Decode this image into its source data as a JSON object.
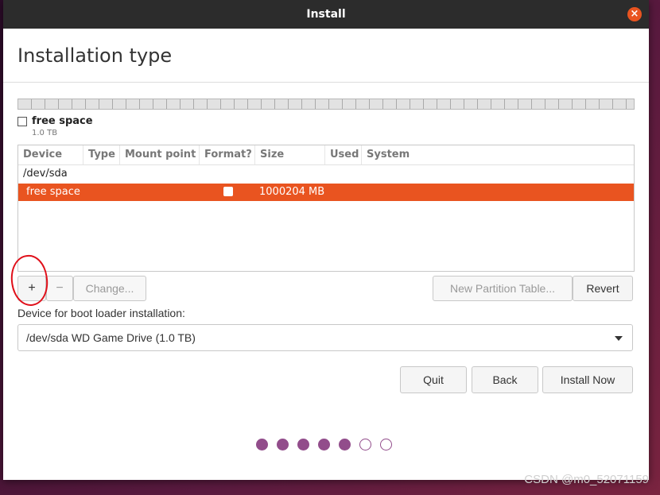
{
  "window": {
    "title": "Install"
  },
  "page": {
    "title": "Installation type"
  },
  "legend": {
    "label": "free space",
    "size": "1.0 TB"
  },
  "table": {
    "columns": [
      "Device",
      "Type",
      "Mount point",
      "Format?",
      "Size",
      "Used",
      "System"
    ],
    "device": "/dev/sda",
    "rows": [
      {
        "device": "free space",
        "type": "",
        "mount": "",
        "format": false,
        "size": "1000204 MB",
        "used": "",
        "system": ""
      }
    ]
  },
  "buttons": {
    "add": "+",
    "remove": "−",
    "change": "Change...",
    "new_table": "New Partition Table...",
    "revert": "Revert",
    "quit": "Quit",
    "back": "Back",
    "install": "Install Now"
  },
  "boot": {
    "label": "Device for boot loader installation:",
    "selected": "/dev/sda WD Game Drive (1.0 TB)"
  },
  "progress": {
    "total_steps": 7,
    "completed_steps": 5
  },
  "colors": {
    "accent": "#e95420",
    "step": "#924d8b",
    "titlebar": "#2c2c2c"
  },
  "watermark": "CSDN @m0_52071159"
}
